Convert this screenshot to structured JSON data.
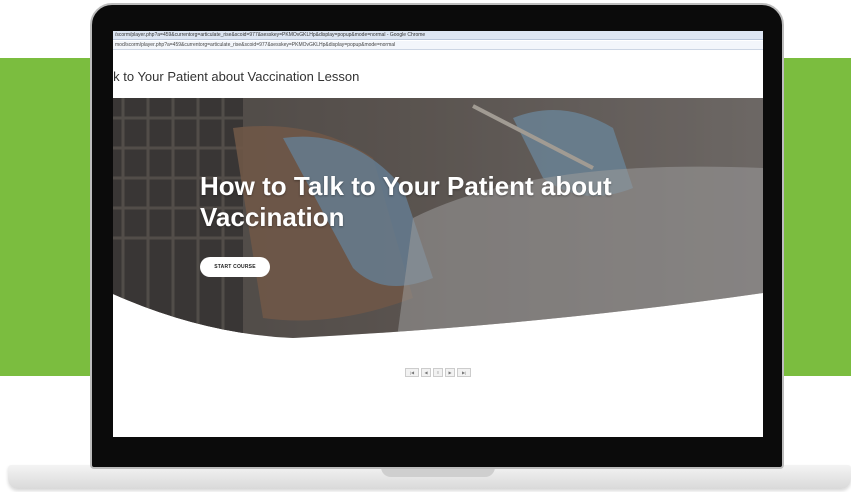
{
  "browser": {
    "title_bar_url": "/scorm/player.php?a=459&currentorg=articulate_rise&scoid=977&sesskey=PKMOvGKLHp&display=popup&mode=normal - Google Chrome",
    "address_url": "mod/scorm/player.php?a=459&currentorg=articulate_rise&scoid=977&sesskey=PKMOvGKLHp&display=popup&mode=normal"
  },
  "page": {
    "lesson_title": "alk to Your Patient about Vaccination Lesson"
  },
  "hero": {
    "heading": "How to Talk to Your Patient about Vaccination",
    "start_button": "START COURSE"
  },
  "player_controls": [
    {
      "icon": "first-icon",
      "glyph": "|◀"
    },
    {
      "icon": "prev-icon",
      "glyph": "◀"
    },
    {
      "icon": "menu-icon",
      "glyph": "≡"
    },
    {
      "icon": "next-icon",
      "glyph": "▶"
    },
    {
      "icon": "last-icon",
      "glyph": "▶|"
    }
  ],
  "colors": {
    "accent_green": "#7bbd3f",
    "hero_overlay": "#3a3a3a"
  }
}
